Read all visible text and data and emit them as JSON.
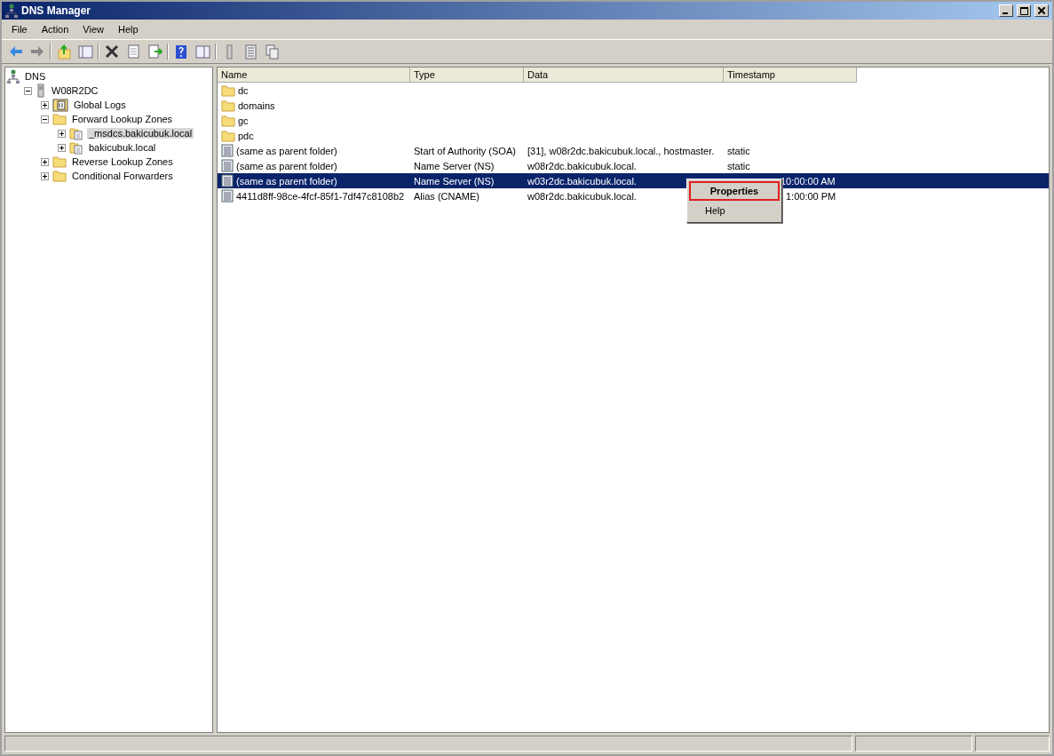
{
  "window": {
    "title": "DNS Manager"
  },
  "menu": [
    "File",
    "Action",
    "View",
    "Help"
  ],
  "tree": [
    {
      "label": "DNS",
      "kind": "network",
      "selected": false,
      "children": [
        {
          "label": "W08R2DC",
          "kind": "server",
          "expanded": true,
          "selected": false,
          "children": [
            {
              "label": "Global Logs",
              "kind": "log",
              "expanded": false,
              "selected": false
            },
            {
              "label": "Forward Lookup Zones",
              "kind": "folder",
              "expanded": true,
              "selected": false,
              "children": [
                {
                  "label": "_msdcs.bakicubuk.local",
                  "kind": "zone",
                  "expanded": false,
                  "selected": true
                },
                {
                  "label": "bakicubuk.local",
                  "kind": "zone",
                  "expanded": false,
                  "selected": false
                }
              ]
            },
            {
              "label": "Reverse Lookup Zones",
              "kind": "folder",
              "expanded": false,
              "selected": false
            },
            {
              "label": "Conditional Forwarders",
              "kind": "folder",
              "expanded": false,
              "selected": false
            }
          ]
        }
      ]
    }
  ],
  "table": {
    "columns": [
      "Name",
      "Type",
      "Data",
      "Timestamp"
    ],
    "rows": [
      {
        "kind": "folder",
        "selected": false,
        "cells": [
          "dc",
          "",
          "",
          ""
        ]
      },
      {
        "kind": "folder",
        "selected": false,
        "cells": [
          "domains",
          "",
          "",
          ""
        ]
      },
      {
        "kind": "folder",
        "selected": false,
        "cells": [
          "gc",
          "",
          "",
          ""
        ]
      },
      {
        "kind": "folder",
        "selected": false,
        "cells": [
          "pdc",
          "",
          "",
          ""
        ]
      },
      {
        "kind": "record",
        "selected": false,
        "cells": [
          "(same as parent folder)",
          "Start of Authority (SOA)",
          "[31], w08r2dc.bakicubuk.local., hostmaster.",
          "static"
        ]
      },
      {
        "kind": "record",
        "selected": false,
        "cells": [
          "(same as parent folder)",
          "Name Server (NS)",
          "w08r2dc.bakicubuk.local.",
          "static"
        ]
      },
      {
        "kind": "record",
        "selected": true,
        "cells": [
          "(same as parent folder)",
          "Name Server (NS)",
          "w03r2dc.bakicubuk.local.",
          "10:00:00 AM"
        ]
      },
      {
        "kind": "record",
        "selected": false,
        "cells": [
          "4411d8ff-98ce-4fcf-85f1-7df47c8108b2",
          "Alias (CNAME)",
          "w08r2dc.bakicubuk.local.",
          "1:00:00 PM"
        ]
      }
    ]
  },
  "context_menu": [
    {
      "label": "Properties",
      "selected": true
    },
    {
      "label": "Help",
      "selected": false
    }
  ]
}
